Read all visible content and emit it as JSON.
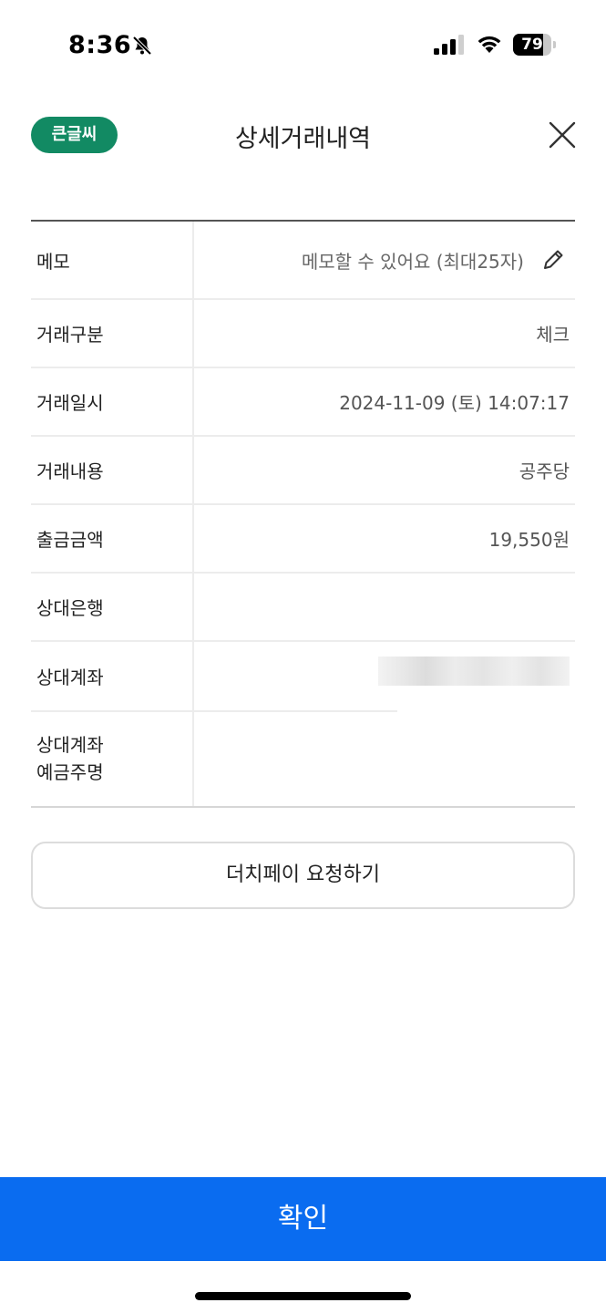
{
  "status_bar": {
    "time": "8:36",
    "battery_level": "79",
    "battery_fraction": 0.79,
    "icons": [
      "bell-slash-icon",
      "signal-icon",
      "wifi-icon",
      "battery-icon"
    ]
  },
  "header": {
    "badge_label": "큰글씨",
    "title": "상세거래내역",
    "close_icon": "close-icon"
  },
  "details": {
    "memo": {
      "label": "메모",
      "placeholder": "메모할 수 있어요 (최대25자)"
    },
    "type": {
      "label": "거래구분",
      "value": "체크"
    },
    "datetime": {
      "label": "거래일시",
      "value": "2024-11-09 (토) 14:07:17"
    },
    "content": {
      "label": "거래내용",
      "value": "공주당"
    },
    "amount": {
      "label": "출금금액",
      "value": "19,550원"
    },
    "bank": {
      "label": "상대은행",
      "value": ""
    },
    "account": {
      "label": "상대계좌",
      "value": ""
    },
    "holder": {
      "label_line1": "상대계좌",
      "label_line2": "예금주명",
      "value": ""
    }
  },
  "dutch_pay_label": "더치페이 요청하기",
  "confirm_label": "확인",
  "colors": {
    "badge": "#128a63",
    "confirm": "#0a6cf0",
    "divider_strong": "#555555",
    "divider_light": "#ececec"
  }
}
